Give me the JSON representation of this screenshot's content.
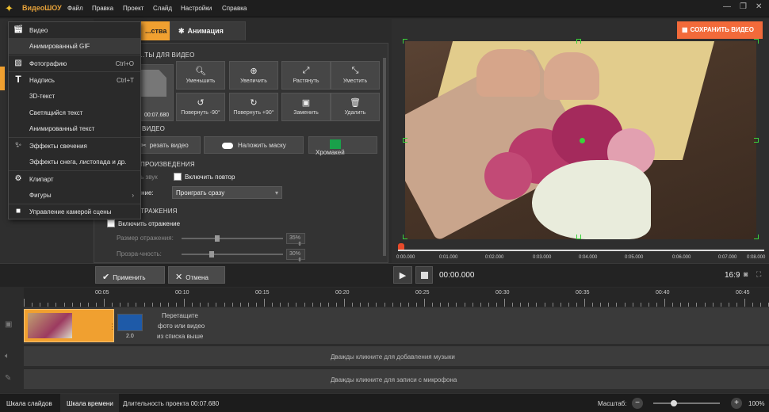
{
  "menubar": {
    "app": "ВидеоШОУ",
    "items": [
      "Файл",
      "Правка",
      "Проект",
      "Слайд",
      "Настройки",
      "Справка"
    ]
  },
  "tabs": {
    "active": "...ства",
    "animation": "Анимация"
  },
  "props": {
    "section_video": "...ТЫ ДЛЯ ВИДЕО",
    "time": "00:07.680",
    "tools": [
      "Уменьшить",
      "Увеличить",
      "Растянуть",
      "Уместить",
      "Повернуть -90°",
      "Повернуть +90°",
      "Заменить",
      "Удалить"
    ],
    "section_video2": "ВИДЕО",
    "cut": "резать видео",
    "mask": "Наложить маску",
    "chroma": "Хромакей",
    "section_play": "ПРОИЗВЕДЕНИЯ",
    "sound": "ить звук",
    "repeat": "Включить повтор",
    "play_label": "дение:",
    "play_value": "Проиграть сразу",
    "section_refl": "ТРАЖЕНИЯ",
    "refl_enable": "Включить отражение",
    "refl_size": "Размер отражения:",
    "refl_size_val": "35%",
    "refl_size_level": 0.35,
    "refl_trans": "Прозра-чность:",
    "refl_trans_val": "30%",
    "refl_trans_level": 0.3
  },
  "save": "СОХРАНИТЬ ВИДЕО",
  "ruler": [
    "0:00.000",
    "0:01.000",
    "0:02.000",
    "0:03.000",
    "0:04.000",
    "0:05.000",
    "0:06.000",
    "0:07.000",
    "0:08.000"
  ],
  "apply": "Применить",
  "cancel": "Отмена",
  "playtime": "00:00.000",
  "aspect": "16:9",
  "timeline": {
    "ticks": [
      "00:05",
      "00:10",
      "00:15",
      "00:20",
      "00:25",
      "00:30",
      "00:35",
      "00:40",
      "00:45"
    ],
    "drag": [
      "Перетащите",
      "фото или видео",
      "из списка выше"
    ],
    "trans_dur": "2.0",
    "music": "Дважды кликните для добавления музыки",
    "mic": "Дважды кликните для записи с микрофона"
  },
  "status": {
    "tab1": "Шкала слайдов",
    "tab2": "Шкала времени",
    "duration": "Длительность проекта 00:07.680",
    "scale": "Масштаб:",
    "zoom": "100%",
    "zoom_level": 0.3
  },
  "menu": [
    {
      "icon": "clapper-icon",
      "label": "Видео",
      "key": ""
    },
    {
      "icon": "",
      "label": "Анимированный GIF",
      "key": ""
    },
    {
      "icon": "image-icon",
      "label": "Фотографию",
      "key": "Ctrl+O"
    },
    {
      "icon": "text-icon",
      "label": "Надпись",
      "key": "Ctrl+T"
    },
    {
      "icon": "",
      "label": "3D-текст",
      "key": ""
    },
    {
      "icon": "",
      "label": "Светящийся текст",
      "key": ""
    },
    {
      "icon": "",
      "label": "Анимированный текст",
      "key": ""
    },
    {
      "icon": "sparkle-icon",
      "label": "Эффекты свечения",
      "key": ""
    },
    {
      "icon": "",
      "label": "Эффекты снега, листопада и др.",
      "key": ""
    },
    {
      "icon": "gear-icon",
      "label": "Клипарт",
      "key": ""
    },
    {
      "icon": "",
      "label": "Фигуры",
      "key": "›"
    },
    {
      "icon": "camera-icon",
      "label": "Управление камерой сцены",
      "key": ""
    }
  ]
}
